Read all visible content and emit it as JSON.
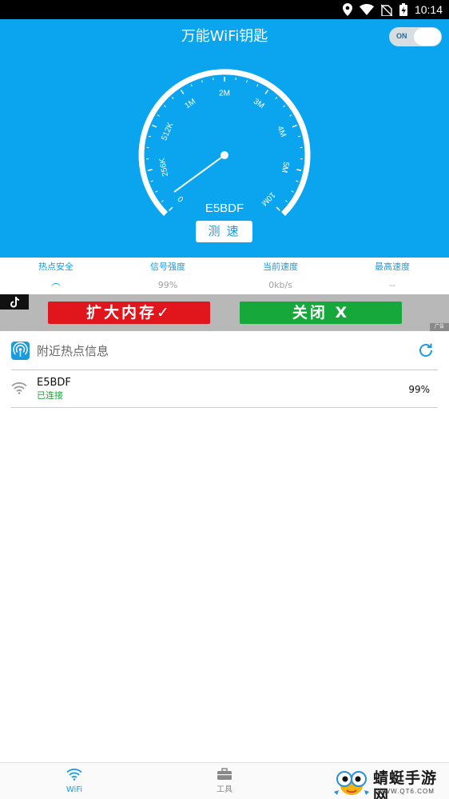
{
  "status_bar": {
    "time": "10:14",
    "icons": [
      "location-icon",
      "wifi-signal-icon",
      "no-sim-icon",
      "battery-charging-icon"
    ]
  },
  "header": {
    "title": "万能WiFi钥匙",
    "toggle_label": "ON",
    "toggle_on": true,
    "ssid": "E5BDF",
    "test_button": "测速",
    "gauge_ticks": [
      "0",
      "256K",
      "512K",
      "1M",
      "2M",
      "3M",
      "4M",
      "5M",
      "10M"
    ],
    "needle_value": "0"
  },
  "stats": [
    {
      "label": "热点安全",
      "value": ""
    },
    {
      "label": "信号强度",
      "value": "99%"
    },
    {
      "label": "当前速度",
      "value": "0kb/s"
    },
    {
      "label": "最高速度",
      "value": "--"
    }
  ],
  "ad": {
    "button1": "扩大内存✓",
    "button2": "关闭 X",
    "tag": "广告"
  },
  "nearby": {
    "title": "附近热点信息",
    "networks": [
      {
        "name": "E5BDF",
        "status": "已连接",
        "signal": "99%"
      }
    ]
  },
  "bottom_nav": [
    {
      "label": "WiFi",
      "icon": "wifi-icon",
      "active": true
    },
    {
      "label": "工具",
      "icon": "toolbox-icon",
      "active": false
    }
  ],
  "watermark": {
    "text": "蜻蜓手游网",
    "url": "WWW.QT6.COM"
  },
  "colors": {
    "accent": "#0aa5ee",
    "connected": "#1e9e3a",
    "ad_red": "#e0161c",
    "ad_green": "#16a83a"
  }
}
